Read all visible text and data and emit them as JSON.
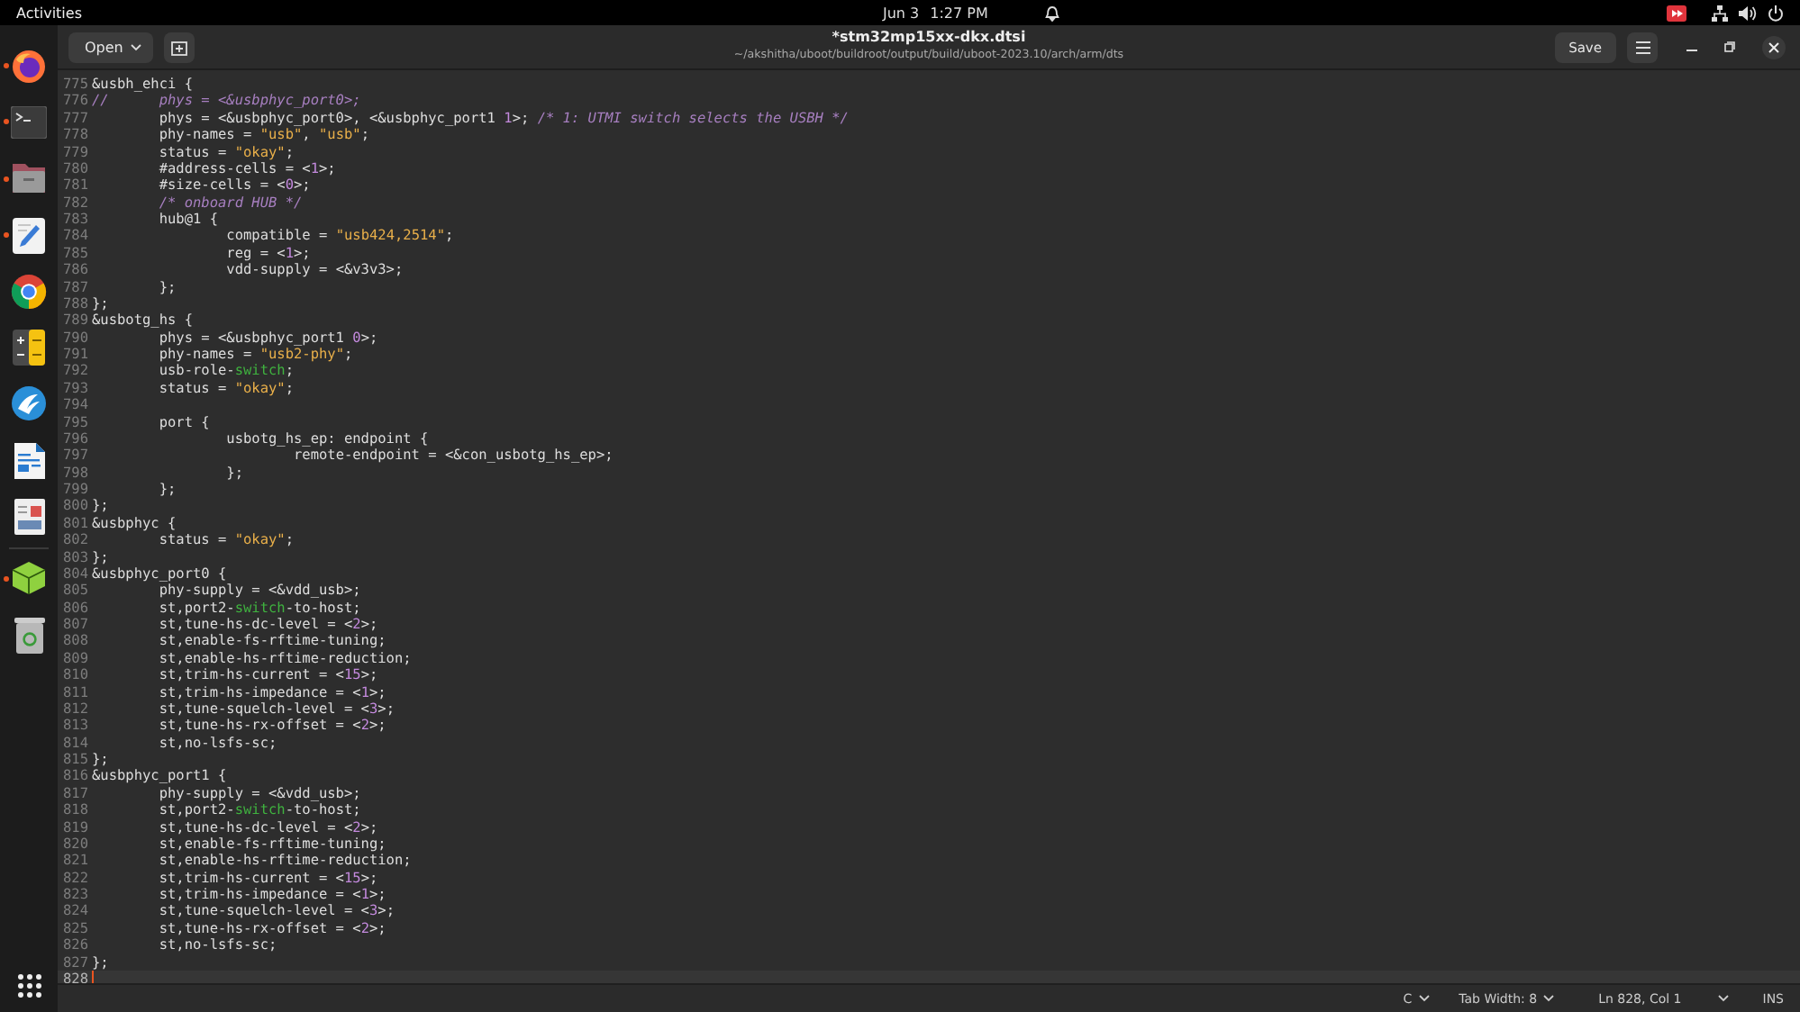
{
  "top_bar": {
    "activities": "Activities",
    "date": "Jun 3",
    "time": "1:27 PM"
  },
  "dock": {
    "apps": [
      {
        "running": true
      },
      {
        "running": true
      },
      {
        "running": true
      },
      {
        "running": true
      },
      {
        "running": false
      },
      {
        "running": false
      },
      {
        "running": false
      },
      {
        "running": false
      },
      {
        "running": false
      },
      {
        "running": true
      },
      {
        "running": false
      }
    ]
  },
  "window": {
    "open_button": "Open",
    "title": "*stm32mp15xx-dkx.dtsi",
    "path": "~/akshitha/uboot/buildroot/output/build/uboot-2023.10/arch/arm/dts",
    "save_button": "Save"
  },
  "editor": {
    "lines": [
      {
        "number": "775",
        "current": false,
        "tokens": [
          {
            "kind": "plain",
            "text": "&usbh_ehci {"
          }
        ]
      },
      {
        "number": "776",
        "current": false,
        "tokens": [
          {
            "kind": "comment",
            "text": "//\tphys = <&usbphyc_port0>;"
          }
        ]
      },
      {
        "number": "777",
        "current": false,
        "tokens": [
          {
            "kind": "plain",
            "text": "\tphys = <&usbphyc_port0>, <&usbphyc_port1 "
          },
          {
            "kind": "number",
            "text": "1"
          },
          {
            "kind": "plain",
            "text": ">; "
          },
          {
            "kind": "comment",
            "text": "/* 1: UTMI switch selects the USBH */"
          }
        ]
      },
      {
        "number": "778",
        "current": false,
        "tokens": [
          {
            "kind": "plain",
            "text": "\tphy-names = "
          },
          {
            "kind": "string",
            "text": "\"usb\""
          },
          {
            "kind": "plain",
            "text": ", "
          },
          {
            "kind": "string",
            "text": "\"usb\""
          },
          {
            "kind": "plain",
            "text": ";"
          }
        ]
      },
      {
        "number": "779",
        "current": false,
        "tokens": [
          {
            "kind": "plain",
            "text": "\tstatus = "
          },
          {
            "kind": "string",
            "text": "\"okay\""
          },
          {
            "kind": "plain",
            "text": ";"
          }
        ]
      },
      {
        "number": "780",
        "current": false,
        "tokens": [
          {
            "kind": "plain",
            "text": "\t#address-cells = <"
          },
          {
            "kind": "number",
            "text": "1"
          },
          {
            "kind": "plain",
            "text": ">;"
          }
        ]
      },
      {
        "number": "781",
        "current": false,
        "tokens": [
          {
            "kind": "plain",
            "text": "\t#size-cells = <"
          },
          {
            "kind": "number",
            "text": "0"
          },
          {
            "kind": "plain",
            "text": ">;"
          }
        ]
      },
      {
        "number": "782",
        "current": false,
        "tokens": [
          {
            "kind": "comment",
            "text": "\t/* onboard HUB */"
          }
        ]
      },
      {
        "number": "783",
        "current": false,
        "tokens": [
          {
            "kind": "plain",
            "text": "\thub@1 {"
          }
        ]
      },
      {
        "number": "784",
        "current": false,
        "tokens": [
          {
            "kind": "plain",
            "text": "\t\tcompatible = "
          },
          {
            "kind": "string",
            "text": "\"usb424,2514\""
          },
          {
            "kind": "plain",
            "text": ";"
          }
        ]
      },
      {
        "number": "785",
        "current": false,
        "tokens": [
          {
            "kind": "plain",
            "text": "\t\treg = <"
          },
          {
            "kind": "number",
            "text": "1"
          },
          {
            "kind": "plain",
            "text": ">;"
          }
        ]
      },
      {
        "number": "786",
        "current": false,
        "tokens": [
          {
            "kind": "plain",
            "text": "\t\tvdd-supply = <&v3v3>;"
          }
        ]
      },
      {
        "number": "787",
        "current": false,
        "tokens": [
          {
            "kind": "plain",
            "text": "\t};"
          }
        ]
      },
      {
        "number": "788",
        "current": false,
        "tokens": [
          {
            "kind": "plain",
            "text": "};"
          }
        ]
      },
      {
        "number": "789",
        "current": false,
        "tokens": [
          {
            "kind": "plain",
            "text": "&usbotg_hs {"
          }
        ]
      },
      {
        "number": "790",
        "current": false,
        "tokens": [
          {
            "kind": "plain",
            "text": "\tphys = <&usbphyc_port1 "
          },
          {
            "kind": "number",
            "text": "0"
          },
          {
            "kind": "plain",
            "text": ">;"
          }
        ]
      },
      {
        "number": "791",
        "current": false,
        "tokens": [
          {
            "kind": "plain",
            "text": "\tphy-names = "
          },
          {
            "kind": "string",
            "text": "\"usb2-phy\""
          },
          {
            "kind": "plain",
            "text": ";"
          }
        ]
      },
      {
        "number": "792",
        "current": false,
        "tokens": [
          {
            "kind": "plain",
            "text": "\tusb-role-"
          },
          {
            "kind": "keyword",
            "text": "switch"
          },
          {
            "kind": "plain",
            "text": ";"
          }
        ]
      },
      {
        "number": "793",
        "current": false,
        "tokens": [
          {
            "kind": "plain",
            "text": "\tstatus = "
          },
          {
            "kind": "string",
            "text": "\"okay\""
          },
          {
            "kind": "plain",
            "text": ";"
          }
        ]
      },
      {
        "number": "794",
        "current": false
      },
      {
        "number": "795",
        "current": false,
        "tokens": [
          {
            "kind": "plain",
            "text": "\tport {"
          }
        ]
      },
      {
        "number": "796",
        "current": false,
        "tokens": [
          {
            "kind": "plain",
            "text": "\t\tusbotg_hs_ep: endpoint {"
          }
        ]
      },
      {
        "number": "797",
        "current": false,
        "tokens": [
          {
            "kind": "plain",
            "text": "\t\t\tremote-endpoint = <&con_usbotg_hs_ep>;"
          }
        ]
      },
      {
        "number": "798",
        "current": false,
        "tokens": [
          {
            "kind": "plain",
            "text": "\t\t};"
          }
        ]
      },
      {
        "number": "799",
        "current": false,
        "tokens": [
          {
            "kind": "plain",
            "text": "\t};"
          }
        ]
      },
      {
        "number": "800",
        "current": false,
        "tokens": [
          {
            "kind": "plain",
            "text": "};"
          }
        ]
      },
      {
        "number": "801",
        "current": false,
        "tokens": [
          {
            "kind": "plain",
            "text": "&usbphyc {"
          }
        ]
      },
      {
        "number": "802",
        "current": false,
        "tokens": [
          {
            "kind": "plain",
            "text": "\tstatus = "
          },
          {
            "kind": "string",
            "text": "\"okay\""
          },
          {
            "kind": "plain",
            "text": ";"
          }
        ]
      },
      {
        "number": "803",
        "current": false,
        "tokens": [
          {
            "kind": "plain",
            "text": "};"
          }
        ]
      },
      {
        "number": "804",
        "current": false,
        "tokens": [
          {
            "kind": "plain",
            "text": "&usbphyc_port0 {"
          }
        ]
      },
      {
        "number": "805",
        "current": false,
        "tokens": [
          {
            "kind": "plain",
            "text": "\tphy-supply = <&vdd_usb>;"
          }
        ]
      },
      {
        "number": "806",
        "current": false,
        "tokens": [
          {
            "kind": "plain",
            "text": "\tst,port2-"
          },
          {
            "kind": "keyword",
            "text": "switch"
          },
          {
            "kind": "plain",
            "text": "-to-host;"
          }
        ]
      },
      {
        "number": "807",
        "current": false,
        "tokens": [
          {
            "kind": "plain",
            "text": "\tst,tune-hs-dc-level = <"
          },
          {
            "kind": "number",
            "text": "2"
          },
          {
            "kind": "plain",
            "text": ">;"
          }
        ]
      },
      {
        "number": "808",
        "current": false,
        "tokens": [
          {
            "kind": "plain",
            "text": "\tst,enable-fs-rftime-tuning;"
          }
        ]
      },
      {
        "number": "809",
        "current": false,
        "tokens": [
          {
            "kind": "plain",
            "text": "\tst,enable-hs-rftime-reduction;"
          }
        ]
      },
      {
        "number": "810",
        "current": false,
        "tokens": [
          {
            "kind": "plain",
            "text": "\tst,trim-hs-current = <"
          },
          {
            "kind": "number",
            "text": "15"
          },
          {
            "kind": "plain",
            "text": ">;"
          }
        ]
      },
      {
        "number": "811",
        "current": false,
        "tokens": [
          {
            "kind": "plain",
            "text": "\tst,trim-hs-impedance = <"
          },
          {
            "kind": "number",
            "text": "1"
          },
          {
            "kind": "plain",
            "text": ">;"
          }
        ]
      },
      {
        "number": "812",
        "current": false,
        "tokens": [
          {
            "kind": "plain",
            "text": "\tst,tune-squelch-level = <"
          },
          {
            "kind": "number",
            "text": "3"
          },
          {
            "kind": "plain",
            "text": ">;"
          }
        ]
      },
      {
        "number": "813",
        "current": false,
        "tokens": [
          {
            "kind": "plain",
            "text": "\tst,tune-hs-rx-offset = <"
          },
          {
            "kind": "number",
            "text": "2"
          },
          {
            "kind": "plain",
            "text": ">;"
          }
        ]
      },
      {
        "number": "814",
        "current": false,
        "tokens": [
          {
            "kind": "plain",
            "text": "\tst,no-lsfs-sc;"
          }
        ]
      },
      {
        "number": "815",
        "current": false,
        "tokens": [
          {
            "kind": "plain",
            "text": "};"
          }
        ]
      },
      {
        "number": "816",
        "current": false,
        "tokens": [
          {
            "kind": "plain",
            "text": "&usbphyc_port1 {"
          }
        ]
      },
      {
        "number": "817",
        "current": false,
        "tokens": [
          {
            "kind": "plain",
            "text": "\tphy-supply = <&vdd_usb>;"
          }
        ]
      },
      {
        "number": "818",
        "current": false,
        "tokens": [
          {
            "kind": "plain",
            "text": "\tst,port2-"
          },
          {
            "kind": "keyword",
            "text": "switch"
          },
          {
            "kind": "plain",
            "text": "-to-host;"
          }
        ]
      },
      {
        "number": "819",
        "current": false,
        "tokens": [
          {
            "kind": "plain",
            "text": "\tst,tune-hs-dc-level = <"
          },
          {
            "kind": "number",
            "text": "2"
          },
          {
            "kind": "plain",
            "text": ">;"
          }
        ]
      },
      {
        "number": "820",
        "current": false,
        "tokens": [
          {
            "kind": "plain",
            "text": "\tst,enable-fs-rftime-tuning;"
          }
        ]
      },
      {
        "number": "821",
        "current": false,
        "tokens": [
          {
            "kind": "plain",
            "text": "\tst,enable-hs-rftime-reduction;"
          }
        ]
      },
      {
        "number": "822",
        "current": false,
        "tokens": [
          {
            "kind": "plain",
            "text": "\tst,trim-hs-current = <"
          },
          {
            "kind": "number",
            "text": "15"
          },
          {
            "kind": "plain",
            "text": ">;"
          }
        ]
      },
      {
        "number": "823",
        "current": false,
        "tokens": [
          {
            "kind": "plain",
            "text": "\tst,trim-hs-impedance = <"
          },
          {
            "kind": "number",
            "text": "1"
          },
          {
            "kind": "plain",
            "text": ">;"
          }
        ]
      },
      {
        "number": "824",
        "current": false,
        "tokens": [
          {
            "kind": "plain",
            "text": "\tst,tune-squelch-level = <"
          },
          {
            "kind": "number",
            "text": "3"
          },
          {
            "kind": "plain",
            "text": ">;"
          }
        ]
      },
      {
        "number": "825",
        "current": false,
        "tokens": [
          {
            "kind": "plain",
            "text": "\tst,tune-hs-rx-offset = <"
          },
          {
            "kind": "number",
            "text": "2"
          },
          {
            "kind": "plain",
            "text": ">;"
          }
        ]
      },
      {
        "number": "826",
        "current": false,
        "tokens": [
          {
            "kind": "plain",
            "text": "\tst,no-lsfs-sc;"
          }
        ]
      },
      {
        "number": "827",
        "current": false,
        "tokens": [
          {
            "kind": "plain",
            "text": "};"
          }
        ]
      },
      {
        "number": "828",
        "current": true
      }
    ]
  },
  "status_bar": {
    "language": "C",
    "tab_width": "Tab Width: 8",
    "position": "Ln 828, Col 1",
    "mode": "INS"
  }
}
